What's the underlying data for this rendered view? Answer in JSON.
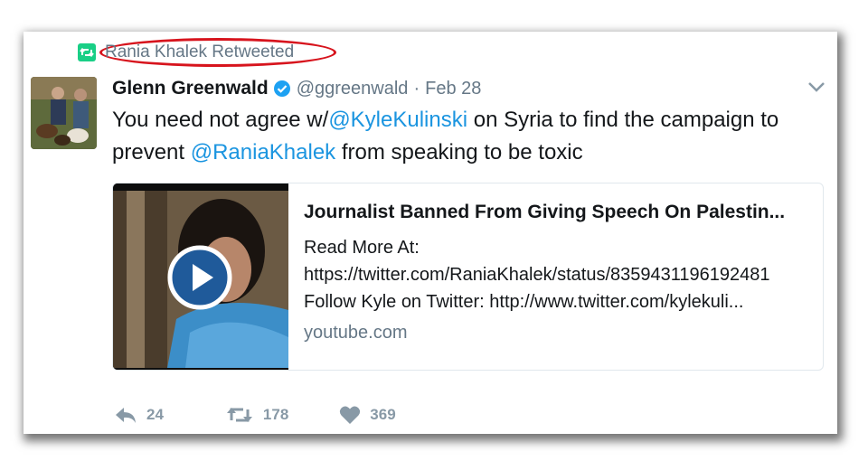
{
  "retweet_context": {
    "icon": "retweet-icon",
    "text": "Rania Khalek Retweeted",
    "icon_color": "#19cf86",
    "highlight_color": "#d7141d"
  },
  "tweet": {
    "author_name": "Glenn Greenwald",
    "verified_icon": "verified-badge-icon",
    "handle": "@ggreenwald",
    "date": "Feb 28",
    "text_parts": [
      "You need not agree w/",
      "@KyleKulinski",
      " on Syria to find the campaign to prevent ",
      "@RaniaKhalek",
      " from speaking to be toxic"
    ],
    "link_color": "#1b95e0"
  },
  "media_card": {
    "title": "Journalist Banned From Giving Speech On Palestin...",
    "desc_line1": "Read More At:",
    "desc_line2": "https://twitter.com/RaniaKhalek/status/8359431196192481",
    "desc_line3": "Follow Kyle on Twitter: http://www.twitter.com/kylekuli...",
    "domain": "youtube.com",
    "play_icon": "play-icon"
  },
  "actions": {
    "reply_count": "24",
    "retweet_count": "178",
    "like_count": "369",
    "icon_color": "#8899a6"
  }
}
